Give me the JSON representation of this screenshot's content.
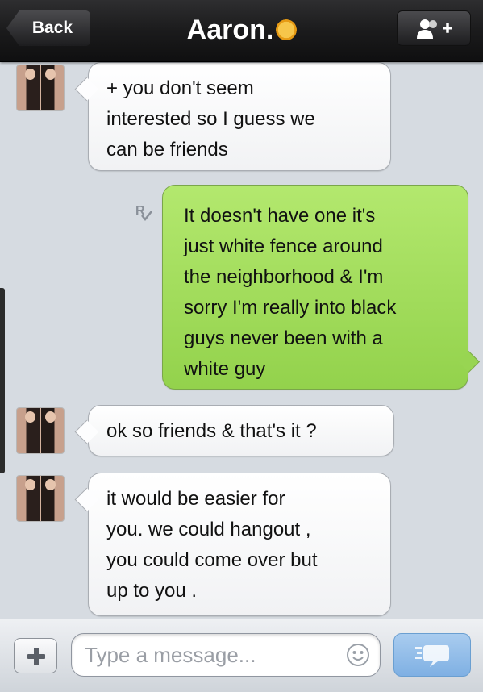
{
  "navbar": {
    "back_label": "Back",
    "title": "Aaron.",
    "title_emoji": "sun-icon",
    "right_button_icon": "add-contact-icon"
  },
  "messages": [
    {
      "direction": "incoming",
      "text": "+ you don't seem\ninterested so I guess we\ncan be friends"
    },
    {
      "direction": "outgoing",
      "status_icon": "read-receipt-icon",
      "text": "It doesn't have one it's\njust white fence around\nthe neighborhood & I'm\nsorry I'm really into black\nguys never been with a\nwhite guy"
    },
    {
      "direction": "incoming",
      "text": "ok so friends & that's it ?"
    },
    {
      "direction": "incoming",
      "text": "it would be easier for\nyou. we could hangout ,\nyou could come over but\nup to you ."
    }
  ],
  "input_bar": {
    "attach_icon": "plus-icon",
    "placeholder": "Type a message...",
    "value": "",
    "emoji_icon": "smiley-icon",
    "send_icon": "send-icon"
  },
  "colors": {
    "outgoing_bubble": "#a3dd5e",
    "incoming_bubble": "#ffffff",
    "navbar": "#1b1b1c",
    "send_button": "#8fbce8"
  }
}
